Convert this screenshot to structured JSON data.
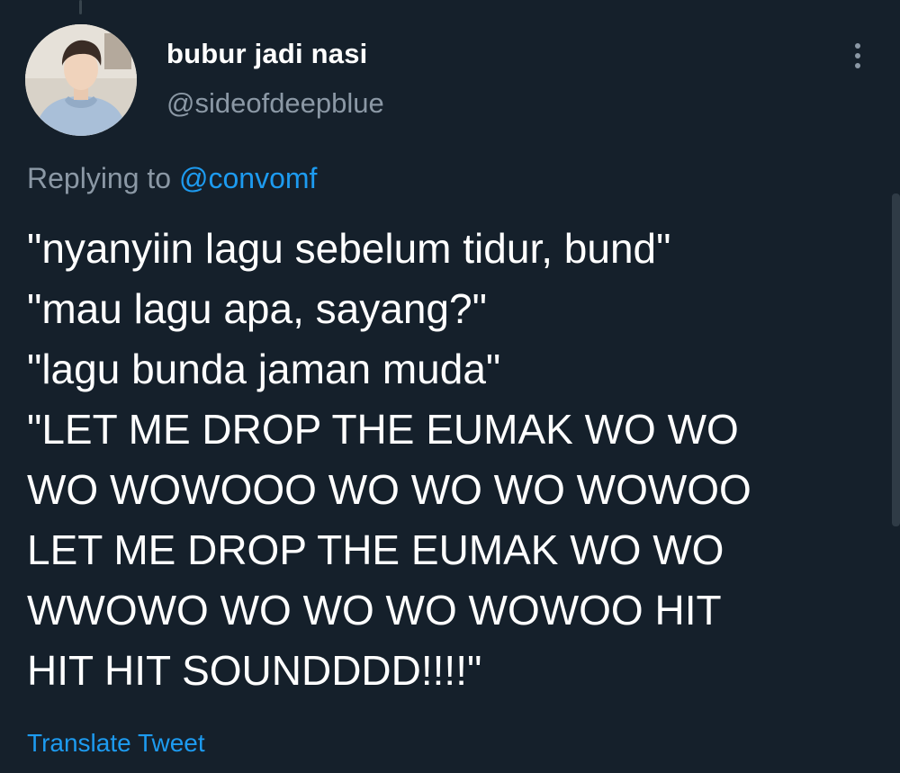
{
  "tweet": {
    "display_name": "bubur jadi nasi",
    "handle": "@sideofdeepblue",
    "replying_prefix": "Replying to",
    "replying_to": "@convomf",
    "lines": [
      "\"nyanyiin lagu sebelum tidur, bund\"",
      "\"mau lagu apa, sayang?\"",
      "\"lagu bunda jaman muda\"",
      "\"LET ME DROP THE EUMAK WO WO",
      "WO WOWOOO WO WO WO WOWOO",
      "LET ME DROP THE EUMAK WO WO",
      "WWOWO WO WO WO WOWOO HIT",
      "HIT HIT SOUNDDDD!!!!\""
    ],
    "translate_label": "Translate Tweet"
  },
  "icons": {
    "more": "more-vertical-icon",
    "avatar": "profile-photo"
  },
  "colors": {
    "background": "#15202b",
    "text_primary": "#ffffff",
    "text_secondary": "#8b98a5",
    "link": "#1d9bf0"
  }
}
